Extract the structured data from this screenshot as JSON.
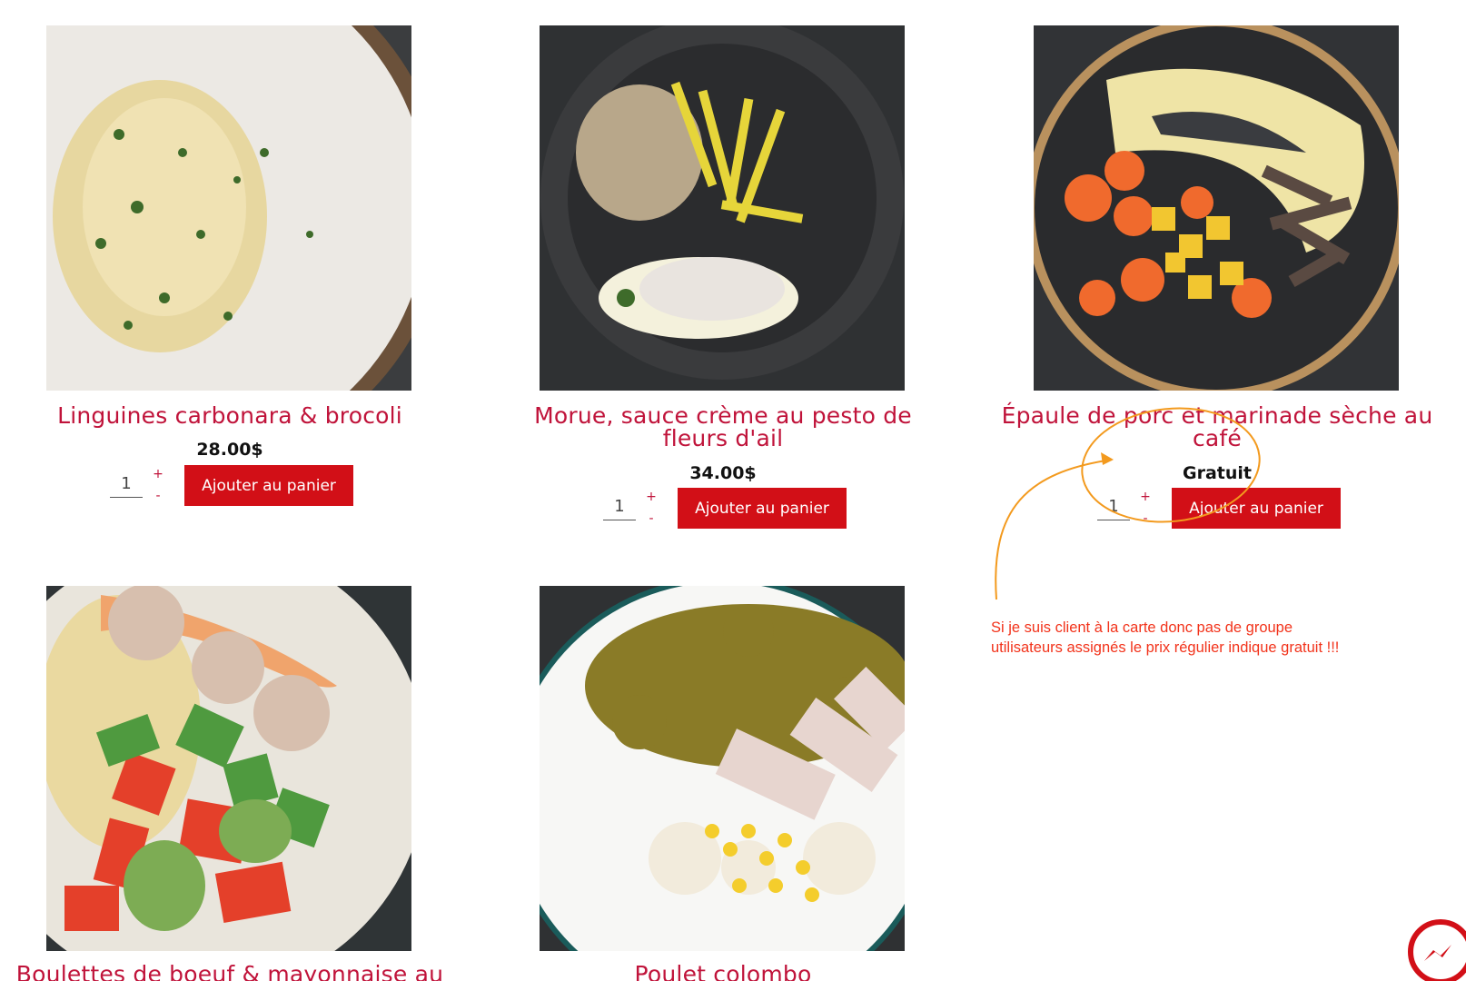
{
  "products": [
    {
      "title": "Linguines carbonara & brocoli",
      "price": "28.00$",
      "qty": "1",
      "plus": "+",
      "minus": "-",
      "add_label": "Ajouter au panier"
    },
    {
      "title": "Morue, sauce crème au pesto de fleurs d'ail",
      "price": "34.00$",
      "qty": "1",
      "plus": "+",
      "minus": "-",
      "add_label": "Ajouter au panier"
    },
    {
      "title": "Épaule de porc et marinade sèche au café",
      "price": "Gratuit",
      "qty": "1",
      "plus": "+",
      "minus": "-",
      "add_label": "Ajouter au panier"
    },
    {
      "title": "Boulettes de boeuf & mayonnaise au"
    },
    {
      "title": "Poulet colombo"
    }
  ],
  "annotation": {
    "text": "Si je suis client à la carte donc pas de groupe utilisateurs assignés le prix régulier indique gratuit !!!",
    "color": "#f2331b",
    "arrow_color": "#f39a1e"
  },
  "colors": {
    "title": "#c0133a",
    "button": "#d20f17"
  },
  "icons": {
    "messenger": "messenger-icon"
  }
}
